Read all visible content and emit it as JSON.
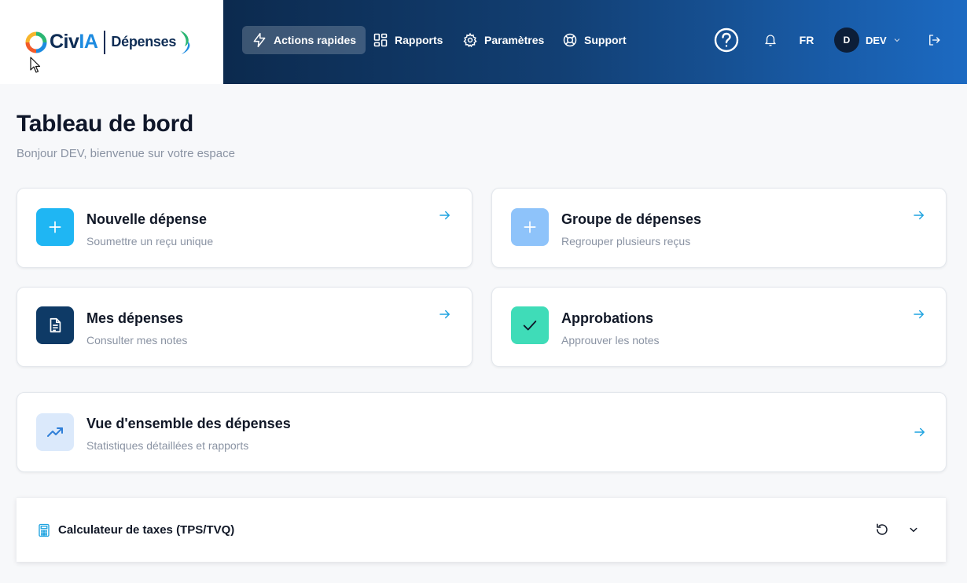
{
  "brand": {
    "logo_civ": "Civ",
    "logo_ia": "IA",
    "logo_product": "Dépenses"
  },
  "nav": {
    "items": [
      {
        "label": "Actions rapides",
        "icon": "bolt-icon",
        "active": true
      },
      {
        "label": "Rapports",
        "icon": "grid-icon",
        "active": false
      },
      {
        "label": "Paramètres",
        "icon": "gear-icon",
        "active": false
      },
      {
        "label": "Support",
        "icon": "lifebuoy-icon",
        "active": false
      }
    ],
    "language": "FR",
    "avatar_initial": "D",
    "user_name": "DEV"
  },
  "page": {
    "title": "Tableau de bord",
    "subtitle": "Bonjour DEV, bienvenue sur votre espace"
  },
  "cards": [
    {
      "title": "Nouvelle dépense",
      "desc": "Soumettre un reçu unique",
      "icon": "plus-icon",
      "icon_bg": "#1fb6f3"
    },
    {
      "title": "Groupe de dépenses",
      "desc": "Regrouper plusieurs reçus",
      "icon": "plus-icon",
      "icon_bg": "#8ec3fa"
    },
    {
      "title": "Mes dépenses",
      "desc": "Consulter mes notes",
      "icon": "document-icon",
      "icon_bg": "#0e3a66"
    },
    {
      "title": "Approbations",
      "desc": "Approuver les notes",
      "icon": "check-icon",
      "icon_bg": "#3fdcb8"
    },
    {
      "title": "Vue d'ensemble des dépenses",
      "desc": "Statistiques détaillées et rapports",
      "icon": "trend-up-icon",
      "icon_bg": "#dbe9fb"
    }
  ],
  "calculator": {
    "title": "Calculateur de taxes (TPS/TVQ)"
  },
  "colors": {
    "accent": "#1fb6f3",
    "nav_start": "#0c2a4e",
    "nav_end": "#1c6ac2"
  }
}
